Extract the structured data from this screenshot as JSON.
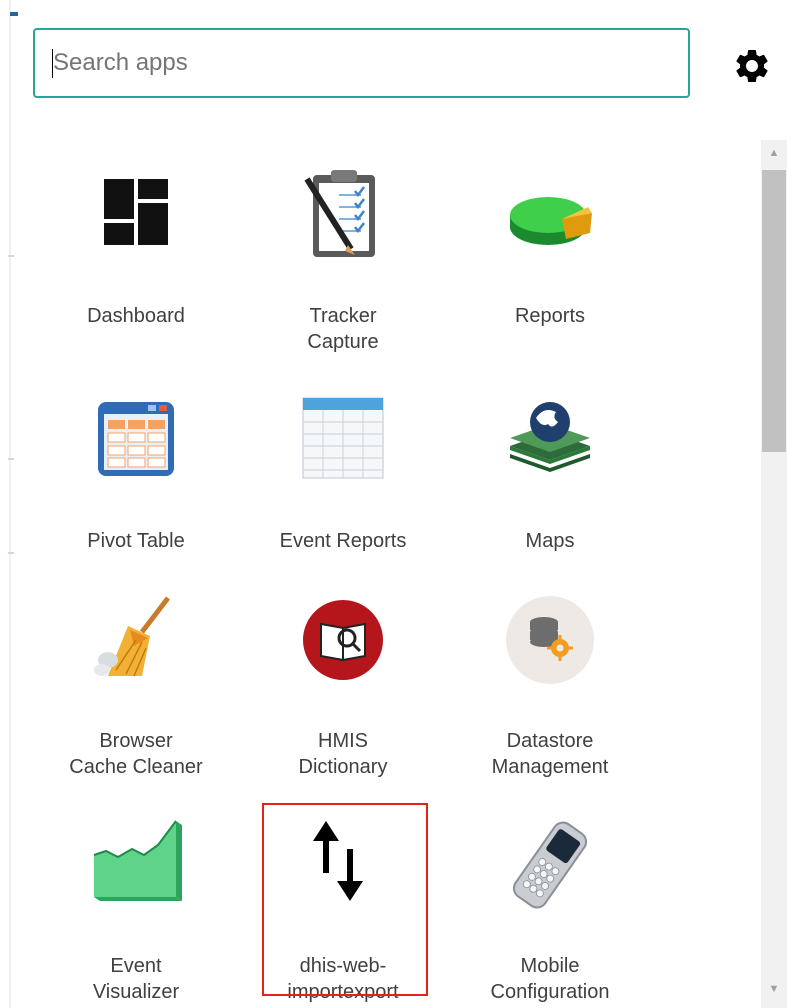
{
  "search": {
    "placeholder": "Search apps",
    "value": ""
  },
  "header": {
    "settings_icon": "gear-icon"
  },
  "apps": [
    {
      "name": "Dashboard",
      "lines": [
        "Dashboard"
      ],
      "icon": "dashboard-icon"
    },
    {
      "name": "Tracker Capture",
      "lines": [
        "Tracker",
        "Capture"
      ],
      "icon": "clipboard-checklist-icon"
    },
    {
      "name": "Reports",
      "lines": [
        "Reports"
      ],
      "icon": "pie-chart-icon"
    },
    {
      "name": "Pivot Table",
      "lines": [
        "Pivot Table"
      ],
      "icon": "pivot-table-icon"
    },
    {
      "name": "Event Reports",
      "lines": [
        "Event Reports"
      ],
      "icon": "spreadsheet-icon"
    },
    {
      "name": "Maps",
      "lines": [
        "Maps"
      ],
      "icon": "globe-layers-icon"
    },
    {
      "name": "Browser Cache Cleaner",
      "lines": [
        "Browser",
        "Cache Cleaner"
      ],
      "icon": "broom-icon"
    },
    {
      "name": "HMIS Dictionary",
      "lines": [
        "HMIS",
        "Dictionary"
      ],
      "icon": "book-magnifier-icon"
    },
    {
      "name": "Datastore Management",
      "lines": [
        "Datastore",
        "Management"
      ],
      "icon": "database-gear-icon"
    },
    {
      "name": "Event Visualizer",
      "lines": [
        "Event",
        "Visualizer"
      ],
      "icon": "area-chart-icon"
    },
    {
      "name": "dhis-web-importexport",
      "lines": [
        "dhis-web-",
        "importexport"
      ],
      "icon": "up-down-arrows-icon",
      "highlighted": true
    },
    {
      "name": "Mobile Configuration",
      "lines": [
        "Mobile",
        "Configuration"
      ],
      "icon": "mobile-phone-icon"
    }
  ],
  "colors": {
    "search_border": "#26a69a",
    "highlight_border": "#e2231a",
    "label_text": "#404040"
  }
}
